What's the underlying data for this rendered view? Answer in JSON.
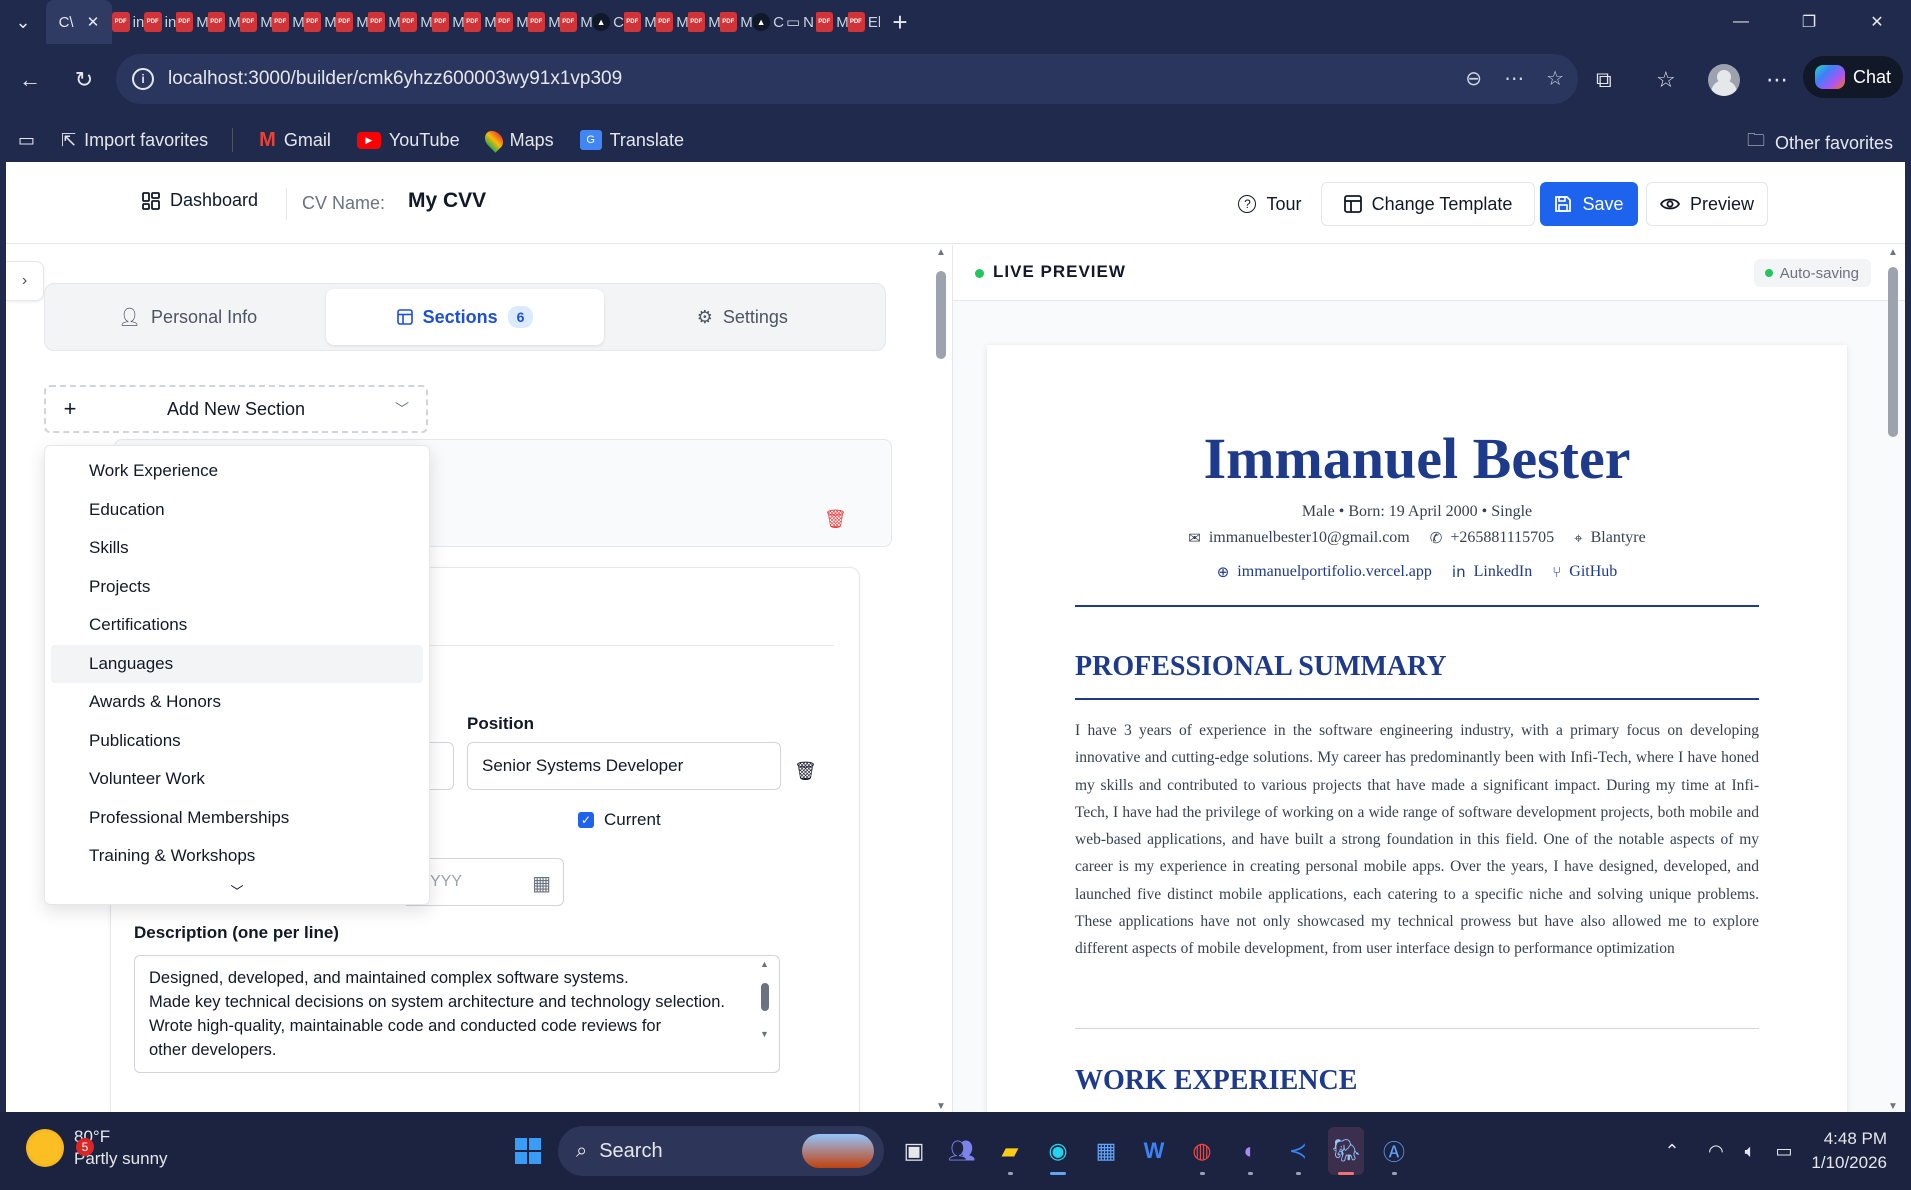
{
  "browser": {
    "active_tab_title": "C\\",
    "mini_tabs": [
      {
        "icon": "pdf",
        "title": "in"
      },
      {
        "icon": "pdf",
        "title": "in"
      },
      {
        "icon": "pdf",
        "title": "M"
      },
      {
        "icon": "pdf",
        "title": "M"
      },
      {
        "icon": "pdf",
        "title": "M"
      },
      {
        "icon": "pdf",
        "title": "M"
      },
      {
        "icon": "pdf",
        "title": "M"
      },
      {
        "icon": "pdf",
        "title": "M"
      },
      {
        "icon": "pdf",
        "title": "M"
      },
      {
        "icon": "pdf",
        "title": "M"
      },
      {
        "icon": "pdf",
        "title": "M"
      },
      {
        "icon": "pdf",
        "title": "M"
      },
      {
        "icon": "pdf",
        "title": "M"
      },
      {
        "icon": "pdf",
        "title": "M"
      },
      {
        "icon": "pdf",
        "title": "M"
      },
      {
        "icon": "triangle",
        "title": "C"
      },
      {
        "icon": "pdf",
        "title": "M"
      },
      {
        "icon": "pdf",
        "title": "M"
      },
      {
        "icon": "pdf",
        "title": "M"
      },
      {
        "icon": "pdf",
        "title": "M"
      },
      {
        "icon": "triangle",
        "title": "C"
      },
      {
        "icon": "page",
        "title": "N"
      },
      {
        "icon": "pdf",
        "title": "M"
      },
      {
        "icon": "pdf",
        "title": "El"
      }
    ],
    "url": "localhost:3000/builder/cmk6yhzz600003wy91x1vp309",
    "chat_label": "Chat",
    "bookmarks": {
      "import": "Import favorites",
      "gmail": "Gmail",
      "youtube": "YouTube",
      "maps": "Maps",
      "translate": "Translate",
      "other": "Other favorites"
    }
  },
  "header": {
    "dashboard": "Dashboard",
    "cv_label": "CV Name:",
    "cv_name": "My CVV",
    "tour": "Tour",
    "change_template": "Change Template",
    "save": "Save",
    "preview": "Preview"
  },
  "editor": {
    "tabs": {
      "personal": "Personal Info",
      "sections": "Sections",
      "sections_count": "6",
      "settings": "Settings"
    },
    "add_section": "Add New Section",
    "section_options": [
      "Work Experience",
      "Education",
      "Skills",
      "Projects",
      "Certifications",
      "Languages",
      "Awards & Honors",
      "Publications",
      "Volunteer Work",
      "Professional Memberships",
      "Training & Workshops"
    ],
    "highlighted_option": "Languages",
    "position_label": "Position",
    "position_value": "Senior Systems Developer",
    "current_label": "Current",
    "date_placeholder_fragment": "YYY",
    "description_label": "Description (one per line)",
    "description_value": "Designed, developed, and maintained complex software systems.\nMade key technical decisions on system architecture and technology selection.\nWrote high-quality, maintainable code and conducted code reviews for\nother developers."
  },
  "preview": {
    "title": "LIVE PREVIEW",
    "autosave": "Auto-saving",
    "cv": {
      "name": "Immanuel Bester",
      "meta": "Male  •  Born: 19 April 2000  •  Single",
      "email": "immanuelbester10@gmail.com",
      "phone": "+265881115705",
      "location": "Blantyre",
      "website": "immanuelportifolio.vercel.app",
      "linkedin": "LinkedIn",
      "github": "GitHub",
      "summary_heading": "PROFESSIONAL SUMMARY",
      "summary": "I have 3 years of experience in the software engineering industry, with a primary focus on developing innovative and cutting-edge solutions. My career has predominantly been with Infi-Tech, where I have honed my skills and contributed to various projects that have made a significant impact. During my time at Infi-Tech, I have had the privilege of working on a wide range of software development projects, both mobile and web-based applications, and have built a strong foundation in this field. One of the notable aspects of my career is my experience in creating personal mobile apps. Over the years, I have designed, developed, and launched five distinct mobile applications, each catering to a specific niche and solving unique problems. These applications have not only showcased my technical prowess but have also allowed me to explore different aspects of mobile development, from user interface design to performance optimization",
      "work_heading": "WORK EXPERIENCE"
    }
  },
  "taskbar": {
    "temperature": "80°F",
    "condition": "Partly sunny",
    "weather_badge": "5",
    "search": "Search",
    "time": "4:48 PM",
    "date": "1/10/2026"
  },
  "colors": {
    "accent": "#1d63ed",
    "cv_heading": "#1e3a8a",
    "live_dot": "#22c55e",
    "danger": "#ef4444"
  }
}
